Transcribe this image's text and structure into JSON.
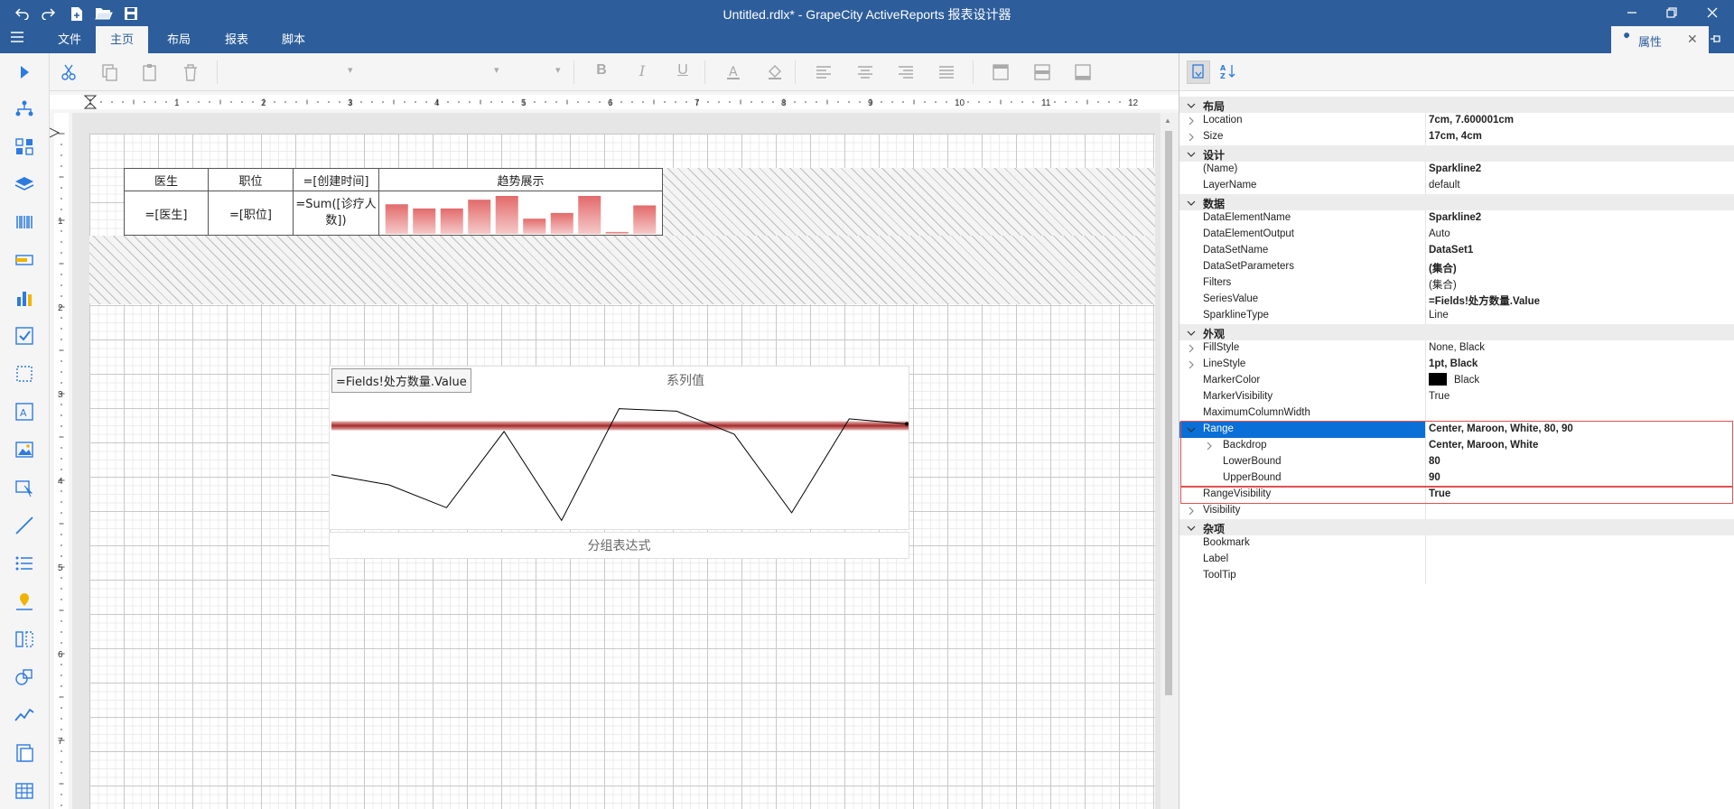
{
  "window": {
    "title": "Untitled.rdlx* - GrapeCity ActiveReports 报表设计器"
  },
  "menu": {
    "tabs": [
      {
        "label": "文件"
      },
      {
        "label": "主页"
      },
      {
        "label": "布局"
      },
      {
        "label": "报表"
      },
      {
        "label": "脚本"
      }
    ],
    "active": "主页",
    "properties_tab": "属性"
  },
  "ruler": {
    "top_labels": [
      "1",
      "2",
      "3",
      "4",
      "5",
      "6",
      "7",
      "8",
      "9",
      "10",
      "11",
      "12"
    ],
    "left_labels": [
      "1",
      "2",
      "3",
      "4",
      "5",
      "6",
      "7"
    ]
  },
  "table": {
    "headers": [
      "医生",
      "职位",
      "=[创建时间]",
      "趋势展示"
    ],
    "row": [
      "=[医生]",
      "=[职位]",
      "=Sum([诊疗人数])"
    ],
    "bar_values": [
      0.78,
      0.67,
      0.67,
      0.9,
      1.0,
      0.4,
      0.55,
      1.0,
      0.05,
      0.75
    ]
  },
  "sparkline": {
    "series_value_expr": "=Fields!处方数量.Value",
    "series_label": "系列值",
    "group_label": "分组表达式",
    "line_values": [
      70,
      66,
      57,
      87,
      52,
      96,
      95,
      86,
      55,
      92,
      90
    ],
    "range": [
      80,
      90
    ]
  },
  "properties": [
    {
      "type": "cat",
      "name": "布局"
    },
    {
      "name": "Location",
      "value": "7cm, 7.600001cm",
      "arrow": "right",
      "bold": true
    },
    {
      "name": "Size",
      "value": "17cm, 4cm",
      "arrow": "right",
      "bold": true
    },
    {
      "type": "cat",
      "name": "设计"
    },
    {
      "name": "(Name)",
      "value": "Sparkline2",
      "bold": true
    },
    {
      "name": "LayerName",
      "value": "default"
    },
    {
      "type": "cat",
      "name": "数据"
    },
    {
      "name": "DataElementName",
      "value": "Sparkline2",
      "bold": true
    },
    {
      "name": "DataElementOutput",
      "value": "Auto"
    },
    {
      "name": "DataSetName",
      "value": "DataSet1",
      "bold": true
    },
    {
      "name": "DataSetParameters",
      "value": "(集合)",
      "bold": true
    },
    {
      "name": "Filters",
      "value": "(集合)"
    },
    {
      "name": "SeriesValue",
      "value": "=Fields!处方数量.Value",
      "bold": true
    },
    {
      "name": "SparklineType",
      "value": "Line"
    },
    {
      "type": "cat",
      "name": "外观"
    },
    {
      "name": "FillStyle",
      "value": "None, Black",
      "arrow": "right"
    },
    {
      "name": "LineStyle",
      "value": "1pt, Black",
      "arrow": "right",
      "bold": true
    },
    {
      "name": "MarkerColor",
      "value": "Black",
      "swatch": "#000000"
    },
    {
      "name": "MarkerVisibility",
      "value": "True"
    },
    {
      "name": "MaximumColumnWidth",
      "value": ""
    },
    {
      "name": "Range",
      "value": "Center, Maroon, White, 80, 90",
      "arrow": "down",
      "bold": true,
      "selected": true
    },
    {
      "name": "Backdrop",
      "value": "Center, Maroon, White",
      "arrow": "right",
      "bold": true,
      "indent": true
    },
    {
      "name": "LowerBound",
      "value": "80",
      "bold": true,
      "indent": true
    },
    {
      "name": "UpperBound",
      "value": "90",
      "bold": true,
      "indent": true
    },
    {
      "name": "RangeVisibility",
      "value": "True",
      "bold": true,
      "outlined": true
    },
    {
      "name": "Visibility",
      "value": "",
      "arrow": "right"
    },
    {
      "type": "cat",
      "name": "杂项"
    },
    {
      "name": "Bookmark",
      "value": ""
    },
    {
      "name": "Label",
      "value": ""
    },
    {
      "name": "ToolTip",
      "value": ""
    }
  ],
  "colors": {
    "accent": "#2d5e9b",
    "selection": "#0a6fd6",
    "highlight_border": "#e05050",
    "range_band": "#a52a2a"
  }
}
